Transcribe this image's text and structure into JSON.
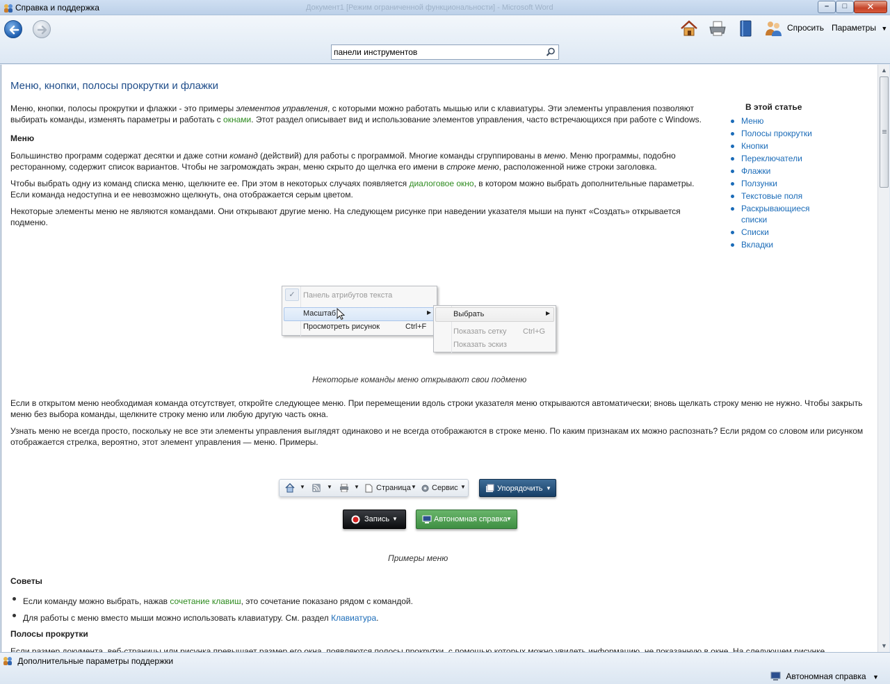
{
  "window": {
    "title": "Справка и поддержка",
    "background_title": "Документ1 [Режим ограниченной функциональности] - Microsoft Word",
    "buttons": {
      "minimize": "–",
      "maximize": "□",
      "close": "✕"
    }
  },
  "toolbar": {
    "back_icon": "back-arrow-icon",
    "forward_icon": "forward-arrow-icon",
    "home_icon": "home-icon",
    "print_icon": "printer-icon",
    "browse_icon": "book-icon",
    "ask_icon": "people-icon",
    "ask_label": "Спросить",
    "options_label": "Параметры"
  },
  "search": {
    "value": "панели инструментов"
  },
  "article": {
    "title": "Меню, кнопки, полосы прокрутки и флажки",
    "intro_a": "Меню, кнопки, полосы прокрутки и флажки - это примеры ",
    "intro_em": "элементов управления",
    "intro_b": ", с которыми можно работать мышью или с клавиатуры. Эти элементы управления позволяют",
    "intro_c": "выбирать команды, изменять параметры и работать с ",
    "intro_link": "окнами",
    "intro_d": ". Этот раздел описывает вид и использование элементов управления, часто встречающихся при работе с Windows.",
    "menu_heading": "Меню",
    "menu_p1_a": "Большинство программ содержат десятки и даже сотни ",
    "menu_p1_em1": "команд",
    "menu_p1_b": " (действий) для работы с программой. Многие команды сгруппированы в ",
    "menu_p1_em2": "меню",
    "menu_p1_c": ". Меню программы, подобно",
    "menu_p1_d": "ресторанному, содержит список вариантов. Чтобы не загромождать экран, меню скрыто до щелчка его имени в ",
    "menu_p1_em3": "строке меню",
    "menu_p1_e": ", расположенной ниже строки заголовка.",
    "menu_p2_a": "Чтобы выбрать одну из команд списка меню, щелкните ее. При этом в некоторых случаях появляется ",
    "menu_p2_link": "диалоговое окно",
    "menu_p2_b": ", в котором можно выбрать дополнительные параметры.",
    "menu_p2_c": "Если команда недоступна и ее невозможно щелкнуть, она отображается серым цветом.",
    "menu_p3_a": "Некоторые элементы меню не являются командами. Они открывают другие меню. На следующем рисунке при наведении указателя мыши на пункт «Создать» открывается",
    "menu_p3_b": "подменю.",
    "fig1_caption": "Некоторые команды меню открывают свои подменю",
    "menu_p4_a": "Если в открытом меню необходимая команда отсутствует, откройте следующее меню. При перемещении вдоль строки указателя меню открываются автоматически; вновь щелкать строку меню не нужно. Чтобы закрыть",
    "menu_p4_b": "меню без выбора команды, щелкните строку меню или любую другую часть окна.",
    "menu_p5_a": "Узнать меню не всегда просто, поскольку не все эти элементы управления выглядят одинаково и не всегда отображаются в строке меню. По каким признакам их можно распознать? Если рядом со словом или рисунком",
    "menu_p5_b": "отображается стрелка, вероятно, этот элемент управления — меню. Примеры.",
    "fig2_caption": "Примеры меню",
    "tips_heading": "Советы",
    "tip1_a": "Если команду можно выбрать, нажав ",
    "tip1_link": "сочетание клавиш",
    "tip1_b": ", это сочетание показано рядом с командой.",
    "tip2_a": "Для работы с меню вместо мыши можно использовать клавиатуру. См. раздел ",
    "tip2_link": "Клавиатура",
    "tip2_b": ".",
    "scroll_heading": "Полосы прокрутки",
    "scroll_p_a": "Если размер документа, веб-страницы или рисунка превышает размер его окна, появляются полосы прокрутки, с помощью которых можно увидеть информацию, не показанную в окне. На следующем рисунке"
  },
  "toc": {
    "title": "В этой статье",
    "items": [
      "Меню",
      "Полосы прокрутки",
      "Кнопки",
      "Переключатели",
      "Флажки",
      "Ползунки",
      "Текстовые поля",
      "Раскрывающиеся",
      "Списки",
      "Вкладки"
    ],
    "item8_line2": "списки"
  },
  "figure_menu": {
    "item_text_toolbar": "Панель атрибутов текста",
    "item_zoom": "Масштаб",
    "item_view": "Просмотреть рисунок",
    "item_view_shortcut": "Ctrl+F",
    "sub_select": "Выбрать",
    "sub_grid": "Показать сетку",
    "sub_grid_shortcut": "Ctrl+G",
    "sub_thumbs": "Показать эскиз"
  },
  "figure_toolbars": {
    "page": "Страница",
    "service": "Сервис",
    "organize": "Упорядочить",
    "record": "Запись",
    "offline_help": "Автономная справка"
  },
  "statusbar": {
    "more_support": "Дополнительные параметры поддержки",
    "offline_help": "Автономная справка"
  }
}
